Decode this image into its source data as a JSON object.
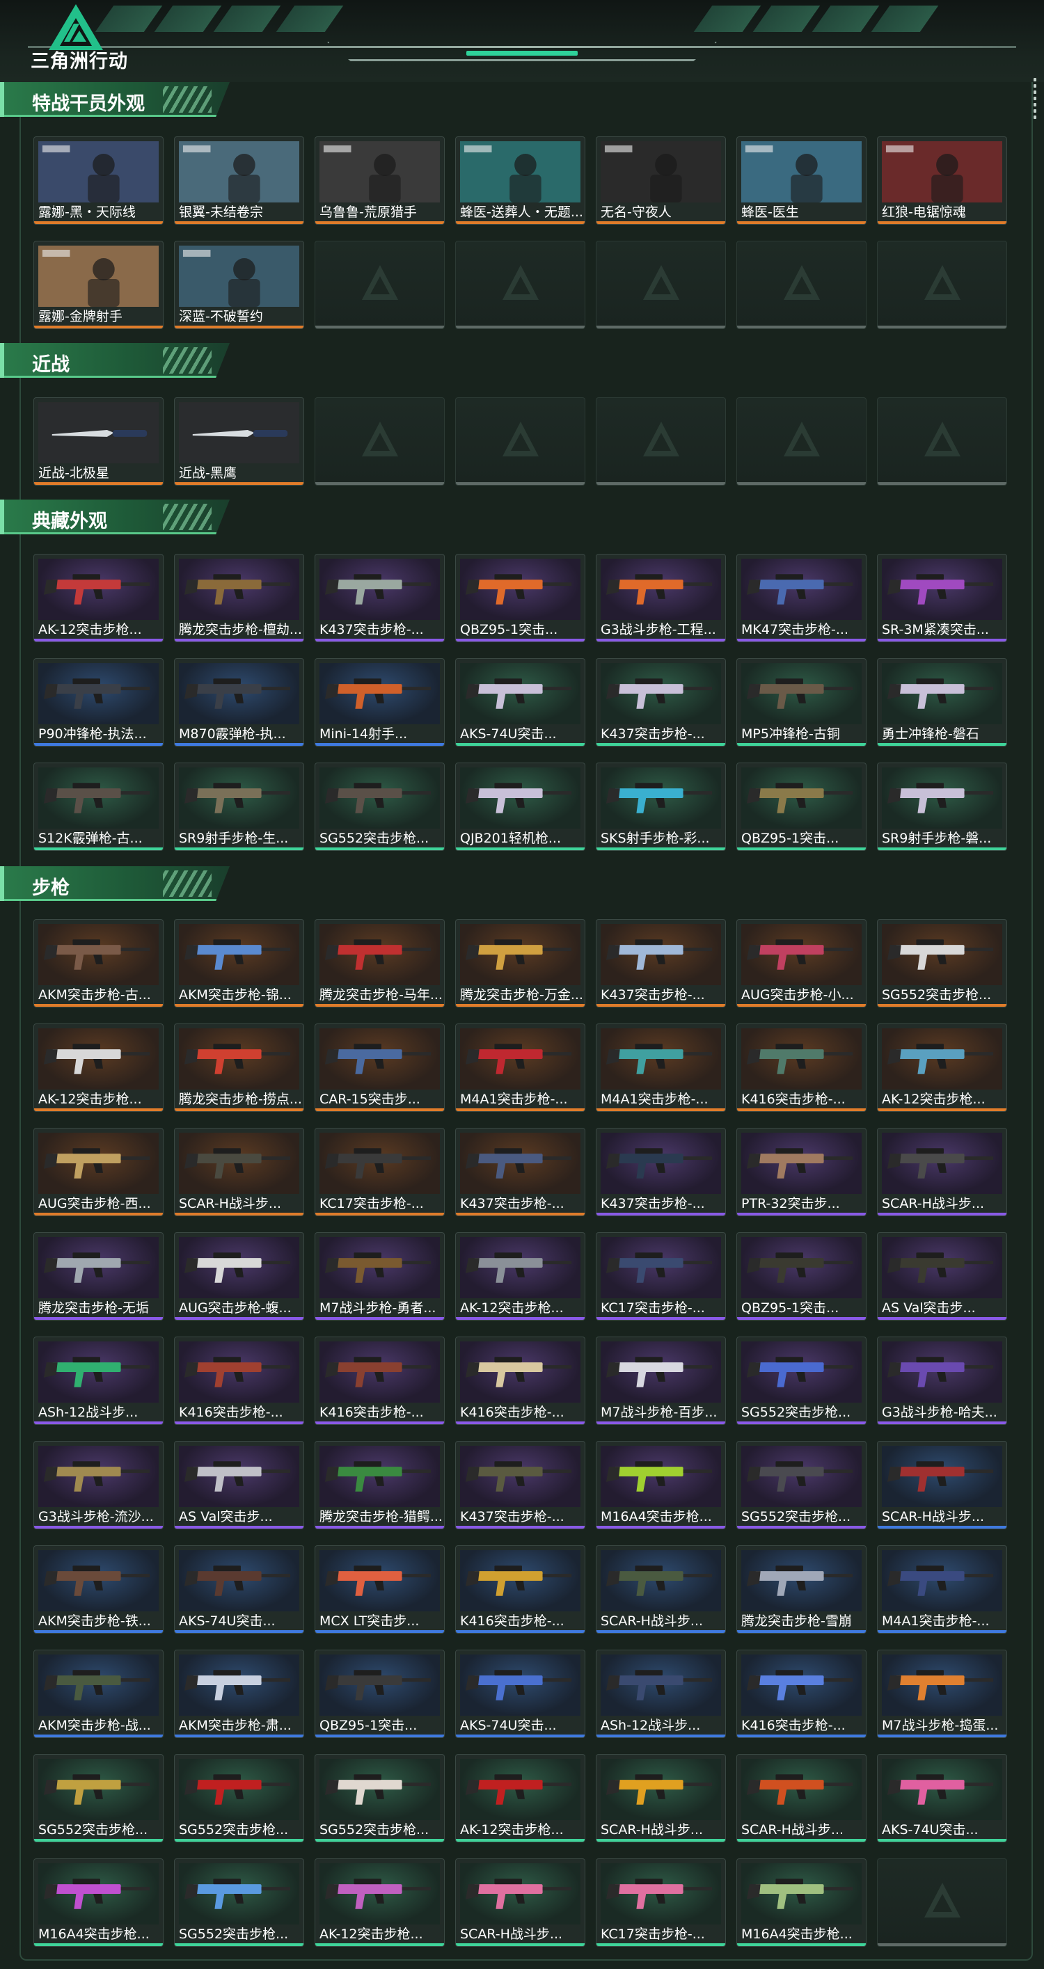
{
  "header": {
    "logo_text": "三角洲行动",
    "logo_name": "delta-force-logo",
    "accent": "#2fd29a"
  },
  "colors": {
    "orange": "#e07c2a",
    "purple": "#8a5ae8",
    "blue": "#3f7ae0",
    "green": "#3fd49a"
  },
  "sections": [
    {
      "title": "特战干员外观",
      "items": [
        {
          "label": "露娜-黑・天际线",
          "rarity": "orange",
          "kind": "operator"
        },
        {
          "label": "银翼-未结卷宗",
          "rarity": "orange",
          "kind": "operator"
        },
        {
          "label": "乌鲁鲁-荒原猎手",
          "rarity": "orange",
          "kind": "operator"
        },
        {
          "label": "蜂医-送葬人・无题...",
          "rarity": "orange",
          "kind": "operator"
        },
        {
          "label": "无名-守夜人",
          "rarity": "orange",
          "kind": "operator"
        },
        {
          "label": "蜂医-医生",
          "rarity": "orange",
          "kind": "operator"
        },
        {
          "label": "红狼-电锯惊魂",
          "rarity": "orange",
          "kind": "operator"
        },
        {
          "label": "露娜-金牌射手",
          "rarity": "orange",
          "kind": "operator"
        },
        {
          "label": "深蓝-不破誓约",
          "rarity": "orange",
          "kind": "operator"
        },
        {
          "label": "",
          "rarity": "empty"
        },
        {
          "label": "",
          "rarity": "empty"
        },
        {
          "label": "",
          "rarity": "empty"
        },
        {
          "label": "",
          "rarity": "empty"
        },
        {
          "label": "",
          "rarity": "empty"
        }
      ]
    },
    {
      "title": "近战",
      "items": [
        {
          "label": "近战-北极星",
          "rarity": "orange",
          "kind": "knife"
        },
        {
          "label": "近战-黑鹰",
          "rarity": "orange",
          "kind": "knife"
        },
        {
          "label": "",
          "rarity": "empty"
        },
        {
          "label": "",
          "rarity": "empty"
        },
        {
          "label": "",
          "rarity": "empty"
        },
        {
          "label": "",
          "rarity": "empty"
        },
        {
          "label": "",
          "rarity": "empty"
        }
      ]
    },
    {
      "title": "典藏外观",
      "items": [
        {
          "label": "AK-12突击步枪...",
          "rarity": "purple",
          "kind": "gun",
          "gun": "#c43a3a"
        },
        {
          "label": "腾龙突击步枪-檀劫...",
          "rarity": "purple",
          "kind": "gun",
          "gun": "#8a6a3a"
        },
        {
          "label": "K437突击步枪-...",
          "rarity": "purple",
          "kind": "gun",
          "gun": "#9aa8a0"
        },
        {
          "label": "QBZ95-1突击...",
          "rarity": "purple",
          "kind": "gun",
          "gun": "#e06a2a"
        },
        {
          "label": "G3战斗步枪-工程...",
          "rarity": "purple",
          "kind": "gun",
          "gun": "#e06a2a"
        },
        {
          "label": "MK47突击步枪-...",
          "rarity": "purple",
          "kind": "gun",
          "gun": "#4a6ab0"
        },
        {
          "label": "SR-3M紧凑突击...",
          "rarity": "purple",
          "kind": "gun",
          "gun": "#a04ac0"
        },
        {
          "label": "P90冲锋枪-执法...",
          "rarity": "blue",
          "kind": "gun",
          "gun": "#3a3f48"
        },
        {
          "label": "M870霰弹枪-执...",
          "rarity": "blue",
          "kind": "gun",
          "gun": "#3a3f48"
        },
        {
          "label": "Mini-14射手...",
          "rarity": "blue",
          "kind": "gun",
          "gun": "#d0602a"
        },
        {
          "label": "AKS-74U突击...",
          "rarity": "green",
          "kind": "gun",
          "gun": "#c8c0d8"
        },
        {
          "label": "K437突击步枪-...",
          "rarity": "green",
          "kind": "gun",
          "gun": "#c8c0d8"
        },
        {
          "label": "MP5冲锋枪-古铜",
          "rarity": "green",
          "kind": "gun",
          "gun": "#6a5a48"
        },
        {
          "label": "勇士冲锋枪-磐石",
          "rarity": "green",
          "kind": "gun",
          "gun": "#c8c0d8"
        },
        {
          "label": "S12K霰弹枪-古...",
          "rarity": "green",
          "kind": "gun",
          "gun": "#5a5048"
        },
        {
          "label": "SR9射手步枪-生...",
          "rarity": "green",
          "kind": "gun",
          "gun": "#7a7058"
        },
        {
          "label": "SG552突击步枪...",
          "rarity": "green",
          "kind": "gun",
          "gun": "#5a5048"
        },
        {
          "label": "QJB201轻机枪...",
          "rarity": "green",
          "kind": "gun",
          "gun": "#c8c0d8"
        },
        {
          "label": "SKS射手步枪-彩...",
          "rarity": "green",
          "kind": "gun",
          "gun": "#3ab0d0"
        },
        {
          "label": "QBZ95-1突击...",
          "rarity": "green",
          "kind": "gun",
          "gun": "#8a7a4a"
        },
        {
          "label": "SR9射手步枪-磐...",
          "rarity": "green",
          "kind": "gun",
          "gun": "#c8c0d8"
        }
      ]
    },
    {
      "title": "步枪",
      "items": [
        {
          "label": "AKM突击步枪-古...",
          "rarity": "orange",
          "kind": "gun",
          "gun": "#7a5a48"
        },
        {
          "label": "AKM突击步枪-锦...",
          "rarity": "orange",
          "kind": "gun",
          "gun": "#5a8ad0"
        },
        {
          "label": "腾龙突击步枪-马年...",
          "rarity": "orange",
          "kind": "gun",
          "gun": "#c03030"
        },
        {
          "label": "腾龙突击步枪-万金...",
          "rarity": "orange",
          "kind": "gun",
          "gun": "#d0a040"
        },
        {
          "label": "K437突击步枪-...",
          "rarity": "orange",
          "kind": "gun",
          "gun": "#a0b8d8"
        },
        {
          "label": "AUG突击步枪-小...",
          "rarity": "orange",
          "kind": "gun",
          "gun": "#c04060"
        },
        {
          "label": "SG552突击步枪...",
          "rarity": "orange",
          "kind": "gun",
          "gun": "#d8d8d8"
        },
        {
          "label": "AK-12突击步枪...",
          "rarity": "orange",
          "kind": "gun",
          "gun": "#d8d8d8"
        },
        {
          "label": "腾龙突击步枪-捞点...",
          "rarity": "orange",
          "kind": "gun",
          "gun": "#d04030"
        },
        {
          "label": "CAR-15突击步...",
          "rarity": "orange",
          "kind": "gun",
          "gun": "#4a6aa0"
        },
        {
          "label": "M4A1突击步枪-...",
          "rarity": "orange",
          "kind": "gun",
          "gun": "#c02830"
        },
        {
          "label": "M4A1突击步枪-...",
          "rarity": "orange",
          "kind": "gun",
          "gun": "#40a0a0"
        },
        {
          "label": "K416突击步枪-...",
          "rarity": "orange",
          "kind": "gun",
          "gun": "#507a6a"
        },
        {
          "label": "AK-12突击步枪...",
          "rarity": "orange",
          "kind": "gun",
          "gun": "#5aa0c0"
        },
        {
          "label": "AUG突击步枪-西...",
          "rarity": "orange",
          "kind": "gun",
          "gun": "#c0a060"
        },
        {
          "label": "SCAR-H战斗步...",
          "rarity": "orange",
          "kind": "gun",
          "gun": "#4a4a40"
        },
        {
          "label": "KC17突击步枪-...",
          "rarity": "orange",
          "kind": "gun",
          "gun": "#3a3a3a"
        },
        {
          "label": "K437突击步枪-...",
          "rarity": "orange",
          "kind": "gun",
          "gun": "#4a5a80"
        },
        {
          "label": "K437突击步枪-...",
          "rarity": "purple",
          "kind": "gun",
          "gun": "#2a3a50"
        },
        {
          "label": "PTR-32突击步...",
          "rarity": "purple",
          "kind": "gun",
          "gun": "#a07a60"
        },
        {
          "label": "SCAR-H战斗步...",
          "rarity": "purple",
          "kind": "gun",
          "gun": "#4a4a4a"
        },
        {
          "label": "腾龙突击步枪-无垢",
          "rarity": "purple",
          "kind": "gun",
          "gun": "#a0a8b0"
        },
        {
          "label": "AUG突击步枪-蝮...",
          "rarity": "purple",
          "kind": "gun",
          "gun": "#d8d8d8"
        },
        {
          "label": "M7战斗步枪-勇者...",
          "rarity": "purple",
          "kind": "gun",
          "gun": "#7a5a30"
        },
        {
          "label": "AK-12突击步枪...",
          "rarity": "purple",
          "kind": "gun",
          "gun": "#8a9098"
        },
        {
          "label": "KC17突击步枪-...",
          "rarity": "purple",
          "kind": "gun",
          "gun": "#3a4a70"
        },
        {
          "label": "QBZ95-1突击...",
          "rarity": "purple",
          "kind": "gun",
          "gun": "#3a3a30"
        },
        {
          "label": "AS Val突击步...",
          "rarity": "purple",
          "kind": "gun",
          "gun": "#3a3a30"
        },
        {
          "label": "ASh-12战斗步...",
          "rarity": "purple",
          "kind": "gun",
          "gun": "#30b070"
        },
        {
          "label": "K416突击步枪-...",
          "rarity": "purple",
          "kind": "gun",
          "gun": "#a04030"
        },
        {
          "label": "K416突击步枪-...",
          "rarity": "purple",
          "kind": "gun",
          "gun": "#8a4030"
        },
        {
          "label": "K416突击步枪-...",
          "rarity": "purple",
          "kind": "gun",
          "gun": "#d8c8a0"
        },
        {
          "label": "M7战斗步枪-百步...",
          "rarity": "purple",
          "kind": "gun",
          "gun": "#d8d8e0"
        },
        {
          "label": "SG552突击步枪...",
          "rarity": "purple",
          "kind": "gun",
          "gun": "#4a6ad0"
        },
        {
          "label": "G3战斗步枪-哈夫...",
          "rarity": "purple",
          "kind": "gun",
          "gun": "#6a4ab0"
        },
        {
          "label": "G3战斗步枪-流沙...",
          "rarity": "purple",
          "kind": "gun",
          "gun": "#a08a50"
        },
        {
          "label": "AS Val突击步...",
          "rarity": "purple",
          "kind": "gun",
          "gun": "#c0c0c8"
        },
        {
          "label": "腾龙突击步枪-猎鳄...",
          "rarity": "purple",
          "kind": "gun",
          "gun": "#3a8a40"
        },
        {
          "label": "K437突击步枪-...",
          "rarity": "purple",
          "kind": "gun",
          "gun": "#5a5a40"
        },
        {
          "label": "M16A4突击步枪...",
          "rarity": "purple",
          "kind": "gun",
          "gun": "#a0d030"
        },
        {
          "label": "SG552突击步枪...",
          "rarity": "purple",
          "kind": "gun",
          "gun": "#4a4a50"
        },
        {
          "label": "SCAR-H战斗步...",
          "rarity": "blue",
          "kind": "gun",
          "gun": "#a03030"
        },
        {
          "label": "AKM突击步枪-铁...",
          "rarity": "blue",
          "kind": "gun",
          "gun": "#6a4a3a"
        },
        {
          "label": "AKS-74U突击...",
          "rarity": "blue",
          "kind": "gun",
          "gun": "#5a3a30"
        },
        {
          "label": "MCX LT突击步...",
          "rarity": "blue",
          "kind": "gun",
          "gun": "#e06040"
        },
        {
          "label": "K416突击步枪-...",
          "rarity": "blue",
          "kind": "gun",
          "gun": "#d0a030"
        },
        {
          "label": "SCAR-H战斗步...",
          "rarity": "blue",
          "kind": "gun",
          "gun": "#4a5a40"
        },
        {
          "label": "腾龙突击步枪-雪崩",
          "rarity": "blue",
          "kind": "gun",
          "gun": "#a0a8b8"
        },
        {
          "label": "M4A1突击步枪-...",
          "rarity": "blue",
          "kind": "gun",
          "gun": "#3a4a80"
        },
        {
          "label": "AKM突击步枪-战...",
          "rarity": "blue",
          "kind": "gun",
          "gun": "#4a5a40"
        },
        {
          "label": "AKM突击步枪-肃...",
          "rarity": "blue",
          "kind": "gun",
          "gun": "#c8d0e0"
        },
        {
          "label": "QBZ95-1突击...",
          "rarity": "blue",
          "kind": "gun",
          "gun": "#3a3a3a"
        },
        {
          "label": "AKS-74U突击...",
          "rarity": "blue",
          "kind": "gun",
          "gun": "#4a70d0"
        },
        {
          "label": "ASh-12战斗步...",
          "rarity": "blue",
          "kind": "gun",
          "gun": "#3a4a70"
        },
        {
          "label": "K416突击步枪-...",
          "rarity": "blue",
          "kind": "gun",
          "gun": "#5a80e0"
        },
        {
          "label": "M7战斗步枪-捣蛋...",
          "rarity": "blue",
          "kind": "gun",
          "gun": "#e08030"
        },
        {
          "label": "SG552突击步枪...",
          "rarity": "green",
          "kind": "gun",
          "gun": "#c0a040"
        },
        {
          "label": "SG552突击步枪...",
          "rarity": "green",
          "kind": "gun",
          "gun": "#c02020"
        },
        {
          "label": "SG552突击步枪...",
          "rarity": "green",
          "kind": "gun",
          "gun": "#e0d8d0"
        },
        {
          "label": "AK-12突击步枪...",
          "rarity": "green",
          "kind": "gun",
          "gun": "#c02020"
        },
        {
          "label": "SCAR-H战斗步...",
          "rarity": "green",
          "kind": "gun",
          "gun": "#e0a020"
        },
        {
          "label": "SCAR-H战斗步...",
          "rarity": "green",
          "kind": "gun",
          "gun": "#d05020"
        },
        {
          "label": "AKS-74U突击...",
          "rarity": "green",
          "kind": "gun",
          "gun": "#e060a0"
        },
        {
          "label": "M16A4突击步枪...",
          "rarity": "green",
          "kind": "gun",
          "gun": "#c050d0"
        },
        {
          "label": "SG552突击步枪...",
          "rarity": "green",
          "kind": "gun",
          "gun": "#5a9ae0"
        },
        {
          "label": "AK-12突击步枪...",
          "rarity": "green",
          "kind": "gun",
          "gun": "#c060c0"
        },
        {
          "label": "SCAR-H战斗步...",
          "rarity": "green",
          "kind": "gun",
          "gun": "#e070a0"
        },
        {
          "label": "KC17突击步枪-...",
          "rarity": "green",
          "kind": "gun",
          "gun": "#e070a0"
        },
        {
          "label": "M16A4突击步枪...",
          "rarity": "green",
          "kind": "gun",
          "gun": "#a0c080"
        },
        {
          "label": "",
          "rarity": "empty"
        }
      ]
    }
  ]
}
